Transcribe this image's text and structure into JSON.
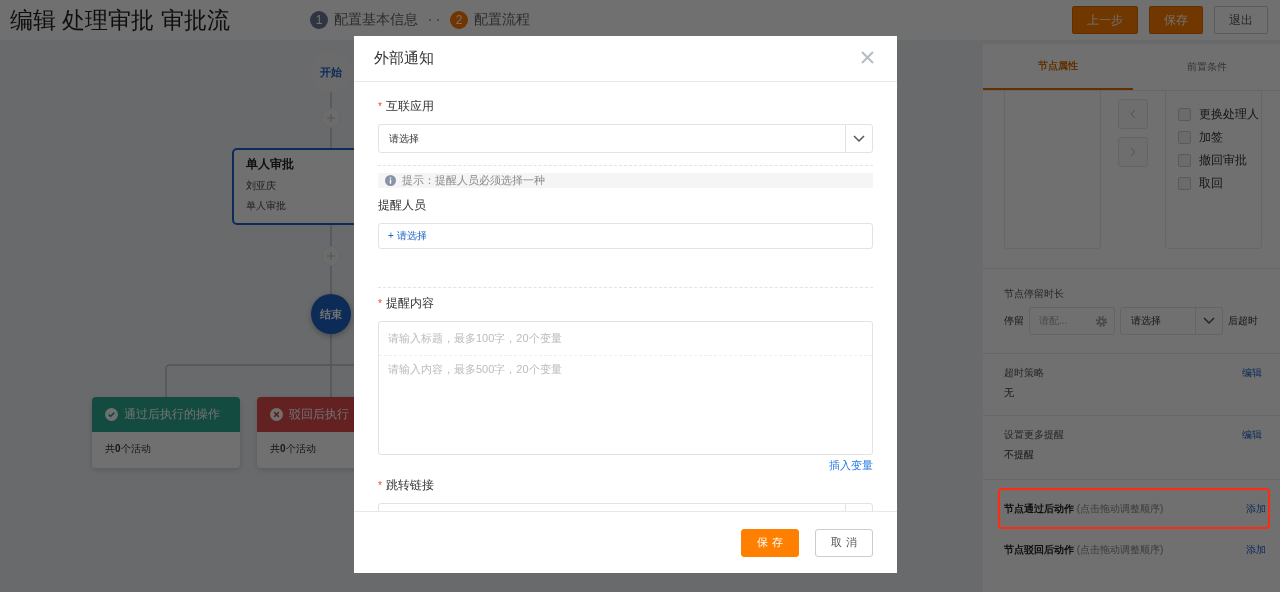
{
  "header": {
    "title": "编辑 处理审批 审批流",
    "steps": [
      {
        "number": "1",
        "label": "配置基本信息",
        "selected": false
      },
      {
        "number": "2",
        "label": "配置流程",
        "selected": true
      }
    ],
    "buttons": [
      {
        "label": "上一步",
        "kind": "primary"
      },
      {
        "label": "保存",
        "kind": "primary"
      },
      {
        "label": "退出",
        "kind": "default"
      }
    ]
  },
  "flow": {
    "start": "开始",
    "approval": {
      "title": "单人审批",
      "assignee": "刘亚庆",
      "type": "单人审批"
    },
    "end": "结束",
    "branches": [
      {
        "kind": "approve",
        "title": "通过后执行的操作",
        "summary": "共**0**个活动"
      },
      {
        "kind": "reject",
        "title": "驳回后执行",
        "summary": "共**0**个活动"
      }
    ]
  },
  "side_panel": {
    "tabs": [
      {
        "label": "节点属性",
        "selected": true
      },
      {
        "label": "前置条件",
        "selected": false
      }
    ],
    "permissions": [
      {
        "label": "更换处理人",
        "checked": false
      },
      {
        "label": "加签",
        "checked": false
      },
      {
        "label": "撤回审批",
        "checked": false
      },
      {
        "label": "取回",
        "checked": false
      }
    ],
    "dwell": {
      "title": "节点停留时长",
      "prefix": "停留",
      "input_placeholder": "请配...",
      "unit_placeholder": "请选择",
      "suffix": "后超时"
    },
    "settings": [
      {
        "title": "超时策略",
        "action": "编辑",
        "value": "无"
      },
      {
        "title": "设置更多提醒",
        "action": "编辑",
        "value": "不提醒"
      }
    ],
    "actions": [
      {
        "title": "节点通过后动作",
        "hint": "(点击拖动调整顺序)",
        "action": "添加",
        "highlighted": true
      },
      {
        "title": "节点驳回后动作",
        "hint": "(点击拖动调整顺序)",
        "action": "添加",
        "highlighted": false
      }
    ]
  },
  "dialog": {
    "title": "外部通知",
    "fields": [
      {
        "kind": "select",
        "label": "互联应用",
        "required_mark": "*",
        "placeholder": "请选择"
      },
      {
        "kind": "divider"
      },
      {
        "kind": "hint",
        "text": "提示：提醒人员必须选择一种"
      },
      {
        "kind": "picker",
        "label": "提醒人员",
        "action": "+ 请选择"
      },
      {
        "kind": "divider"
      },
      {
        "kind": "content",
        "label": "提醒内容",
        "required_mark": "*",
        "title_placeholder": "请输入标题，最多100字，20个变量",
        "body_placeholder": "请输入内容，最多500字，20个变量",
        "link": "插入变量"
      },
      {
        "kind": "select",
        "label": "跳转链接",
        "required_mark": "*"
      }
    ],
    "buttons": [
      {
        "label": "保 存",
        "kind": "primary"
      },
      {
        "label": "取 消",
        "kind": "default"
      }
    ]
  }
}
